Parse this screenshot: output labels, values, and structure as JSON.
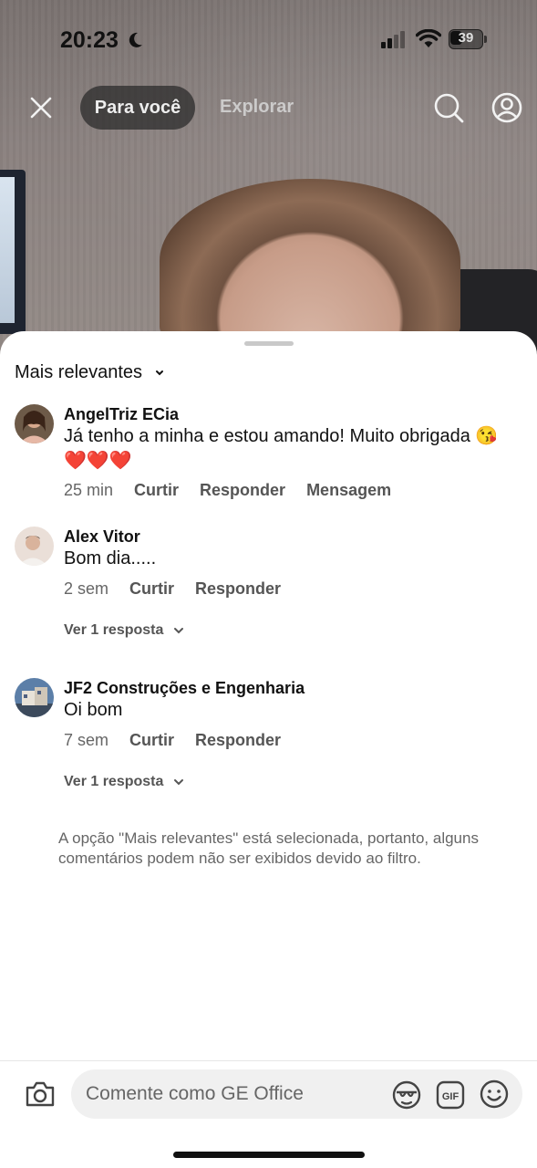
{
  "status_bar": {
    "time": "20:23",
    "battery": "39",
    "battery_level": 0.39
  },
  "top_nav": {
    "tab_foryou": "Para você",
    "tab_explore": "Explorar"
  },
  "sort": {
    "label": "Mais relevantes"
  },
  "comments": [
    {
      "name": "AngelTriz ECia",
      "text": "Já tenho a minha e estou amando! Muito obrigada 😘",
      "text2": "❤️❤️❤️",
      "time": "25 min",
      "like": "Curtir",
      "reply": "Responder",
      "message": "Mensagem"
    },
    {
      "name": "Alex Vitor",
      "text": "Bom dia.....",
      "time": "2 sem",
      "like": "Curtir",
      "reply": "Responder",
      "replies": "Ver 1 resposta"
    },
    {
      "name": "JF2 Construções e Engenharia",
      "text": "Oi bom",
      "time": "7 sem",
      "like": "Curtir",
      "reply": "Responder",
      "replies": "Ver 1 resposta"
    }
  ],
  "filter_note": "A opção \"Mais relevantes\" está selecionada, portanto, alguns comentários podem não ser exibidos devido ao filtro.",
  "composer": {
    "placeholder": "Comente como GE Office"
  },
  "colors": {
    "text": "#111111",
    "muted": "#666666",
    "input_bg": "#f0f0f0"
  }
}
